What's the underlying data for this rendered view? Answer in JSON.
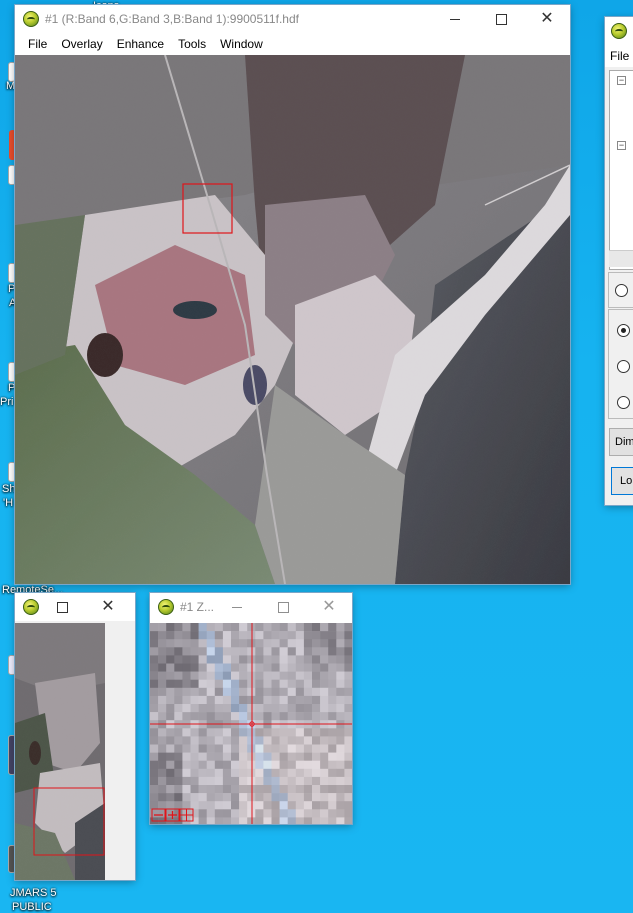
{
  "desktop": {
    "icons": [
      {
        "label": "Icons"
      },
      {
        "label": "M"
      },
      {
        "label": "P"
      },
      {
        "label": "A"
      },
      {
        "label": "P"
      },
      {
        "label": "Pri"
      },
      {
        "label": "Sh"
      },
      {
        "label": "'H"
      },
      {
        "label": "RemoteSe..."
      },
      {
        "label": "JMARS 5"
      },
      {
        "label": "PUBLIC"
      }
    ]
  },
  "main_window": {
    "title": "#1 (R:Band 6,G:Band 3,B:Band 1):9900511f.hdf",
    "menu": [
      "File",
      "Overlay",
      "Enhance",
      "Tools",
      "Window"
    ]
  },
  "dialog_window": {
    "menu_file": "File",
    "buttons": [
      "Dim",
      "Lo"
    ]
  },
  "scroll_window": {
    "title": ""
  },
  "zoom_window": {
    "title": "#1 Z..."
  },
  "colors": {
    "desktop": "#16b3f0",
    "zoom_box": "#e0141a"
  }
}
